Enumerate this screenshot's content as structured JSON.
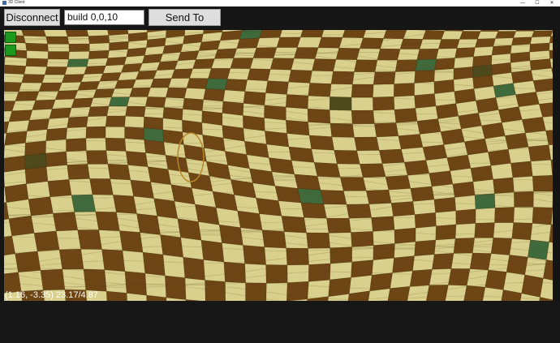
{
  "window": {
    "title": "3D Client",
    "minimize_glyph": "—",
    "maximize_glyph": "☐",
    "close_glyph": "✕"
  },
  "toolbar": {
    "disconnect_label": "Disconnect",
    "command_value": "build 0,0,10",
    "send_label": "Send To Server"
  },
  "viewport": {
    "status_readout": "(1.16, -3.35) 23.17/4.87",
    "colors": {
      "light_tile": "#d8d08c",
      "dark_tile": "#6e4514",
      "green_tile": "#3f6a3c",
      "dark_green_tile": "#4d4a1c"
    }
  },
  "hud": {
    "indicator_top": "",
    "indicator_bottom": ""
  }
}
